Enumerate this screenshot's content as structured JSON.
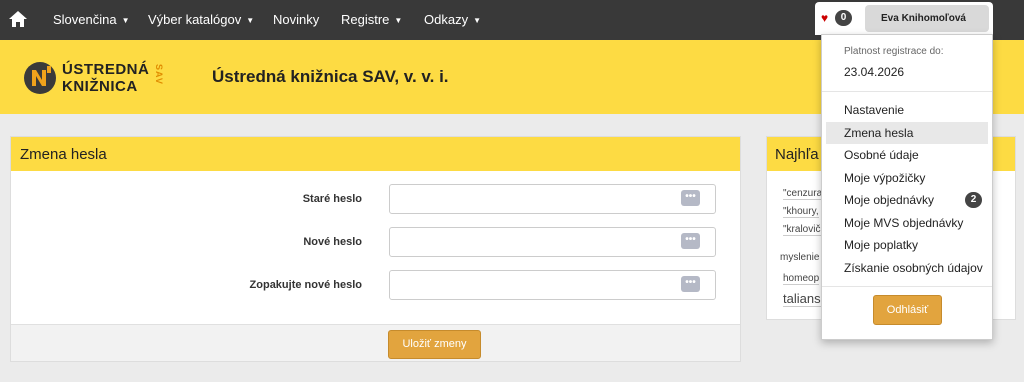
{
  "nav": {
    "home_icon": "home-icon",
    "items": [
      {
        "label": "Slovenčina",
        "dropdown": true
      },
      {
        "label": "Výber katalógov",
        "dropdown": true
      },
      {
        "label": "Novinky",
        "dropdown": false
      },
      {
        "label": "Registre",
        "dropdown": true
      },
      {
        "label": "Odkazy",
        "dropdown": true
      }
    ],
    "caret": "▼"
  },
  "user": {
    "favorites_icon": "heart-icon",
    "favorites_count": "0",
    "name": "Eva Knihomoľová"
  },
  "header": {
    "logo_line1": "ÚSTREDNÁ",
    "logo_line2": "KNIŽNICA",
    "logo_sav": "SAV",
    "title": "Ústredná knižnica SAV, v. v. i."
  },
  "form": {
    "title": "Zmena hesla",
    "fields": [
      {
        "label": "Staré heslo",
        "value": ""
      },
      {
        "label": "Nové heslo",
        "value": ""
      },
      {
        "label": "Zopakujte nové heslo",
        "value": ""
      }
    ],
    "password_icon": "dots-icon",
    "save_label": "Uložiť zmeny"
  },
  "sidebar": {
    "title": "Najhľa",
    "tags": [
      "\"cenzura",
      "\"khoury,",
      "\"kraloviča",
      "myslenie",
      "homeop",
      "talians"
    ]
  },
  "dropdown": {
    "reg_label": "Platnost registrace do:",
    "reg_date": "23.04.2026",
    "items": [
      {
        "label": "Nastavenie",
        "badge": ""
      },
      {
        "label": "Zmena hesla",
        "badge": "",
        "active": true
      },
      {
        "label": "Osobné údaje",
        "badge": ""
      },
      {
        "label": "Moje výpožičky",
        "badge": ""
      },
      {
        "label": "Moje objednávky",
        "badge": "2"
      },
      {
        "label": "Moje MVS objednávky",
        "badge": ""
      },
      {
        "label": "Moje poplatky",
        "badge": ""
      },
      {
        "label": "Získanie osobných údajov",
        "badge": ""
      }
    ],
    "logout_label": "Odhlásiť"
  },
  "colors": {
    "nav_bg": "#393939",
    "accent_yellow": "#fddb43",
    "button_orange": "#e2a43e",
    "heart_red": "#cc0000"
  }
}
